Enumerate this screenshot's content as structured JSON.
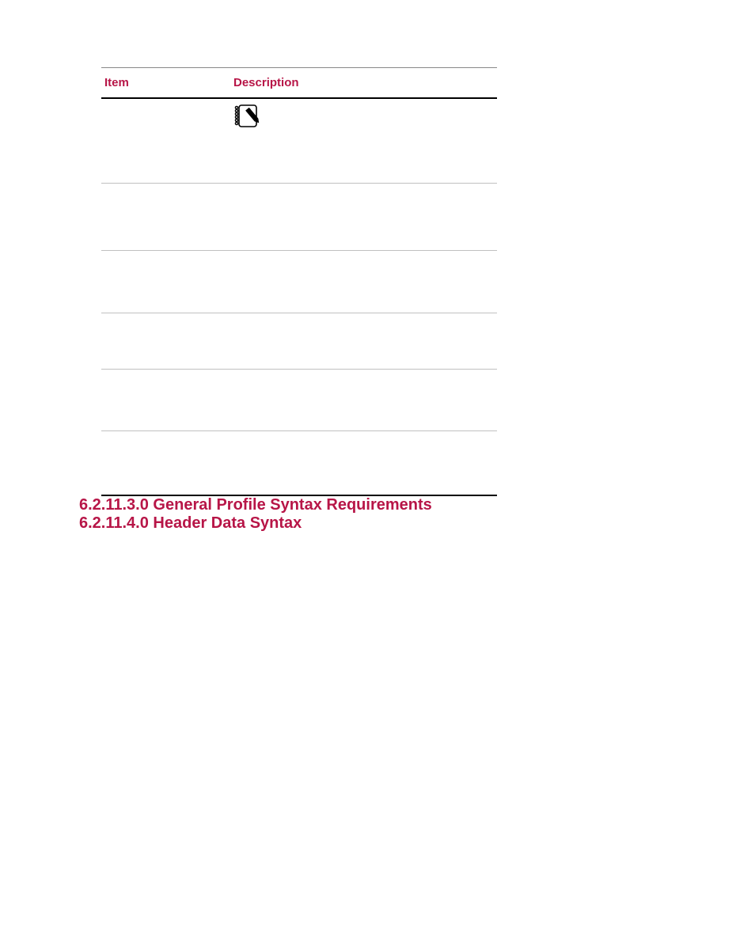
{
  "table": {
    "headers": {
      "item": "Item",
      "description": "Description"
    }
  },
  "sections": {
    "s1": "6.2.11.3.0 General Profile Syntax Requirements",
    "s2": "6.2.11.4.0 Header Data Syntax"
  }
}
